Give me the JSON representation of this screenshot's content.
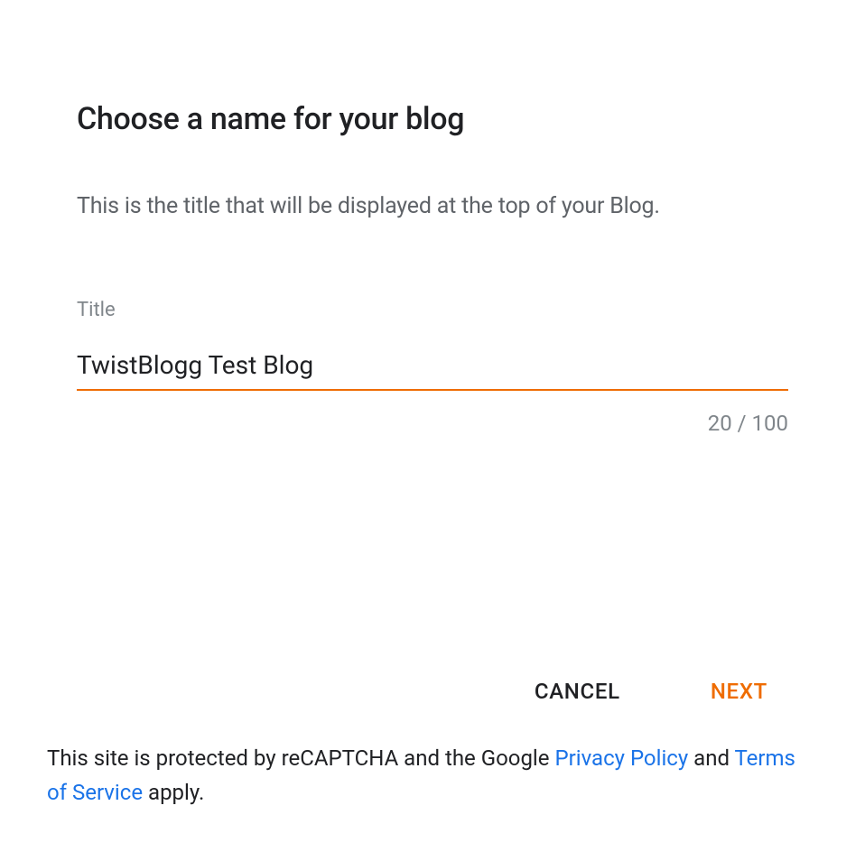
{
  "heading": "Choose a name for your blog",
  "subtitle": "This is the title that will be displayed at the top of your Blog.",
  "field": {
    "label": "Title",
    "value": "TwistBlogg Test Blog",
    "counter": "20 / 100"
  },
  "buttons": {
    "cancel": "CANCEL",
    "next": "NEXT"
  },
  "footer": {
    "prefix": "This site is protected by reCAPTCHA and the Google ",
    "privacy": "Privacy Policy",
    "mid": " and ",
    "terms": "Terms of Service",
    "suffix": " apply."
  }
}
